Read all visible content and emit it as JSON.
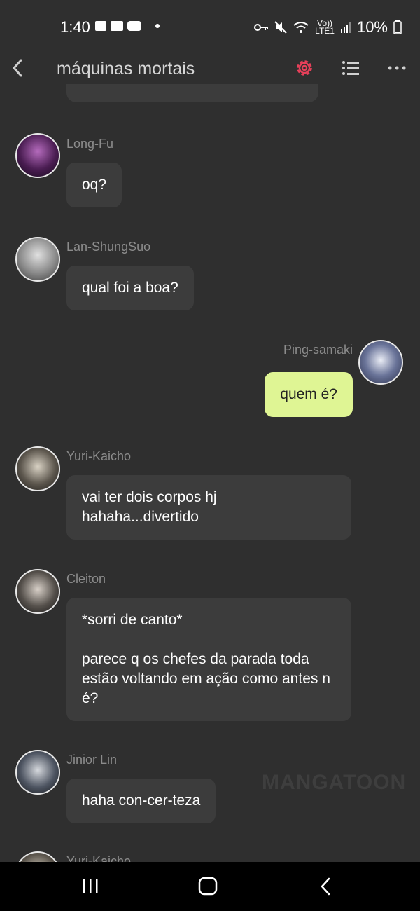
{
  "status_bar": {
    "time": "1:40",
    "network_label_top": "Vo))",
    "network_label_bottom": "LTE1",
    "battery": "10%"
  },
  "header": {
    "title": "máquinas mortais",
    "back_icon": "chevron-left-icon",
    "settings_icon": "gear-icon",
    "list_icon": "list-icon",
    "more_icon": "more-horizontal-icon",
    "settings_color": "#e8405a"
  },
  "messages": [
    {
      "author": "Long-Fu",
      "text": "oq?",
      "mine": false
    },
    {
      "author": "Lan-ShungSuo",
      "text": "qual foi a boa?",
      "mine": false
    },
    {
      "author": "Ping-samaki",
      "text": "quem é?",
      "mine": true
    },
    {
      "author": "Yuri-Kaicho",
      "text": "vai ter dois corpos hj\nhahaha...divertido",
      "mine": false
    },
    {
      "author": "Cleiton",
      "text": "*sorri de canto*\n\nparece q os chefes da parada toda estão voltando em ação como antes n é?",
      "mine": false
    },
    {
      "author": "Jinior Lin",
      "text": "haha con-cer-teza",
      "mine": false
    },
    {
      "author": "Yuri-Kaicho",
      "text": "",
      "mine": false
    }
  ],
  "watermark": "MANGATOON",
  "colors": {
    "background": "#2f2f2f",
    "bubble": "#3c3c3c",
    "my_bubble": "#dff594",
    "name_text": "#8c8c8c"
  }
}
